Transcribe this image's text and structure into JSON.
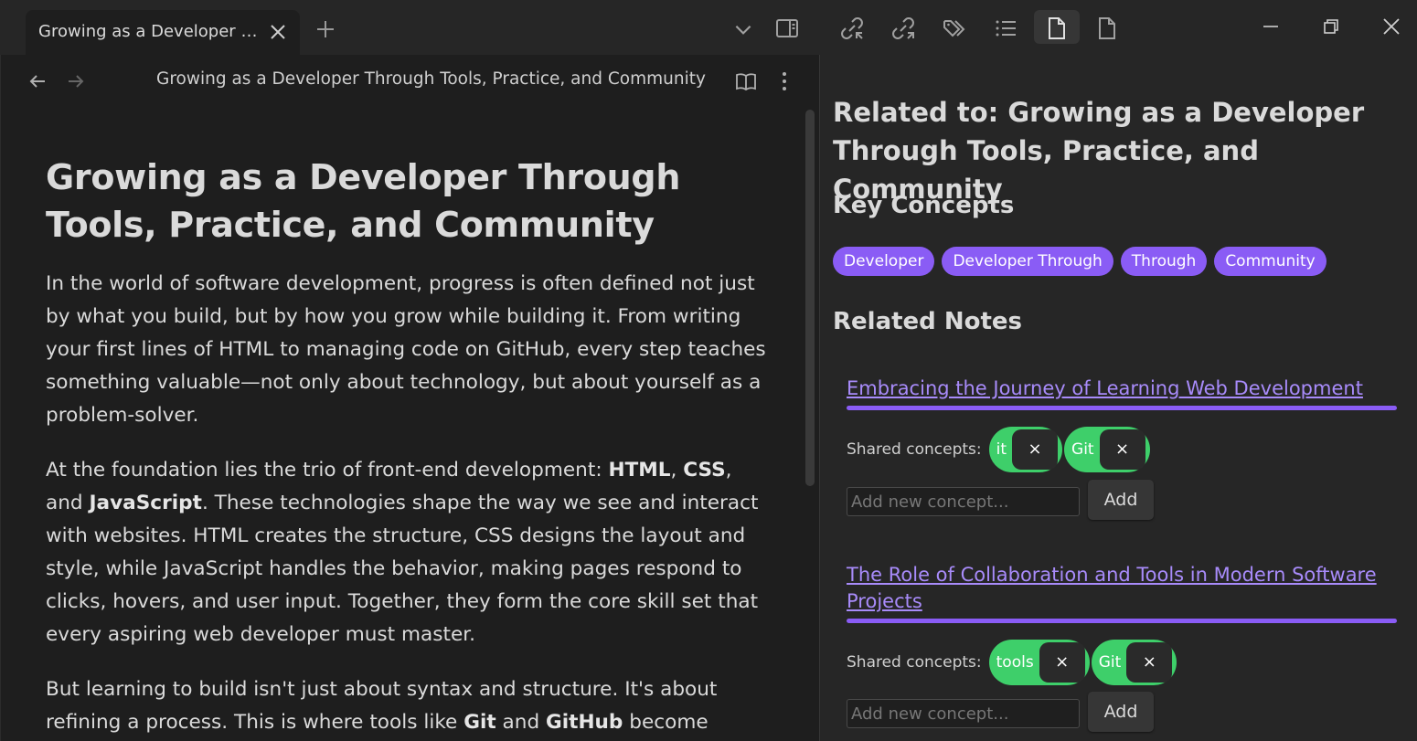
{
  "tab": {
    "title": "Growing as a Developer T..."
  },
  "view_header": {
    "title": "Growing as a Developer Through Tools, Practice, and Community"
  },
  "document": {
    "title": "Growing as a Developer Through Tools, Practice, and Community",
    "p1": "In the world of software development, progress is often defined not just by what you build, but by how you grow while building it. From writing your first lines of HTML to managing code on GitHub, every step teaches something valuable—not only about technology, but about yourself as a problem-solver.",
    "p2": {
      "a": "At the foundation lies the trio of front-end development: ",
      "html": "HTML",
      "b": ", ",
      "css": "CSS",
      "c": ", and ",
      "js": "JavaScript",
      "d": ". These technologies shape the way we see and interact with websites. HTML creates the structure, CSS designs the layout and style, while JavaScript handles the behavior, making pages respond to clicks, hovers, and user input. Together, they form the core skill set that every aspiring web developer must master."
    },
    "p3": {
      "a": "But learning to build isn't just about syntax and structure. It's about refining a process. This is where tools like ",
      "git": "Git",
      "b": " and ",
      "github": "GitHub",
      "c": " become"
    }
  },
  "related_panel": {
    "title": "Related to: Growing as a Developer Through Tools, Practice, and Community",
    "key_concepts_heading": "Key Concepts",
    "key_concepts": [
      "Developer",
      "Developer Through",
      "Through",
      "Community"
    ],
    "related_notes_heading": "Related Notes",
    "shared_label": "Shared concepts:",
    "remove_glyph": "×",
    "add_placeholder": "Add new concept...",
    "add_label": "Add",
    "notes": [
      {
        "title": "Embracing the Journey of Learning Web Development",
        "shared": [
          "it",
          "Git"
        ]
      },
      {
        "title": "The Role of Collaboration and Tools in Modern Software Projects",
        "shared": [
          "tools",
          "Git"
        ]
      }
    ]
  },
  "icons": {
    "tab_close": "close-icon",
    "new_tab": "plus-icon",
    "tab_list": "chevron-down-icon",
    "sidebar_toggle": "sidebar-toggle-icon",
    "backlinks": "link-in-icon",
    "outgoing": "link-out-icon",
    "tags": "tags-icon",
    "outline": "list-icon",
    "active_file": "file-icon",
    "file": "file-outline-icon",
    "minimize": "minimize-icon",
    "restore": "restore-icon",
    "close_window": "close-icon",
    "back": "arrow-left-icon",
    "forward": "arrow-right-icon",
    "reading_view": "book-open-icon",
    "more": "more-vertical-icon"
  },
  "colors": {
    "accent": "#8a5cf5",
    "link": "#a88bfa",
    "pill": "#3ecf6a",
    "bg": "#1e1e1e",
    "panel": "#262626"
  }
}
